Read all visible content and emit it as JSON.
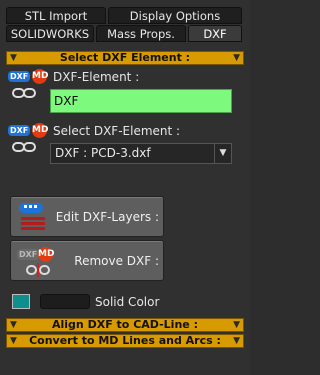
{
  "tabs_row1": [
    "STL Import",
    "Display Options"
  ],
  "tabs_row2": [
    "SOLIDWORKS",
    "Mass Props.",
    "DXF"
  ],
  "section_select": "Select DXF Element :",
  "dxf_element_label": "DXF-Element :",
  "dxf_element_value": "DXF",
  "select_dxf_label": "Select DXF-Element :",
  "select_dxf_value": "DXF : PCD-3.dxf",
  "edit_layers_label": "Edit DXF-Layers :",
  "remove_dxf_label": "Remove DXF :",
  "solid_color_label": "Solid Color",
  "section_align": "Align DXF to CAD-Line :",
  "section_convert": "Convert to MD Lines and Arcs :",
  "icons": {
    "dxf_tag": "DXF",
    "md_tag": "MD"
  },
  "colors": {
    "accent_bar": "#d79a00",
    "input_green": "#7dfa7d",
    "solid_color": "#0f8e8e"
  }
}
